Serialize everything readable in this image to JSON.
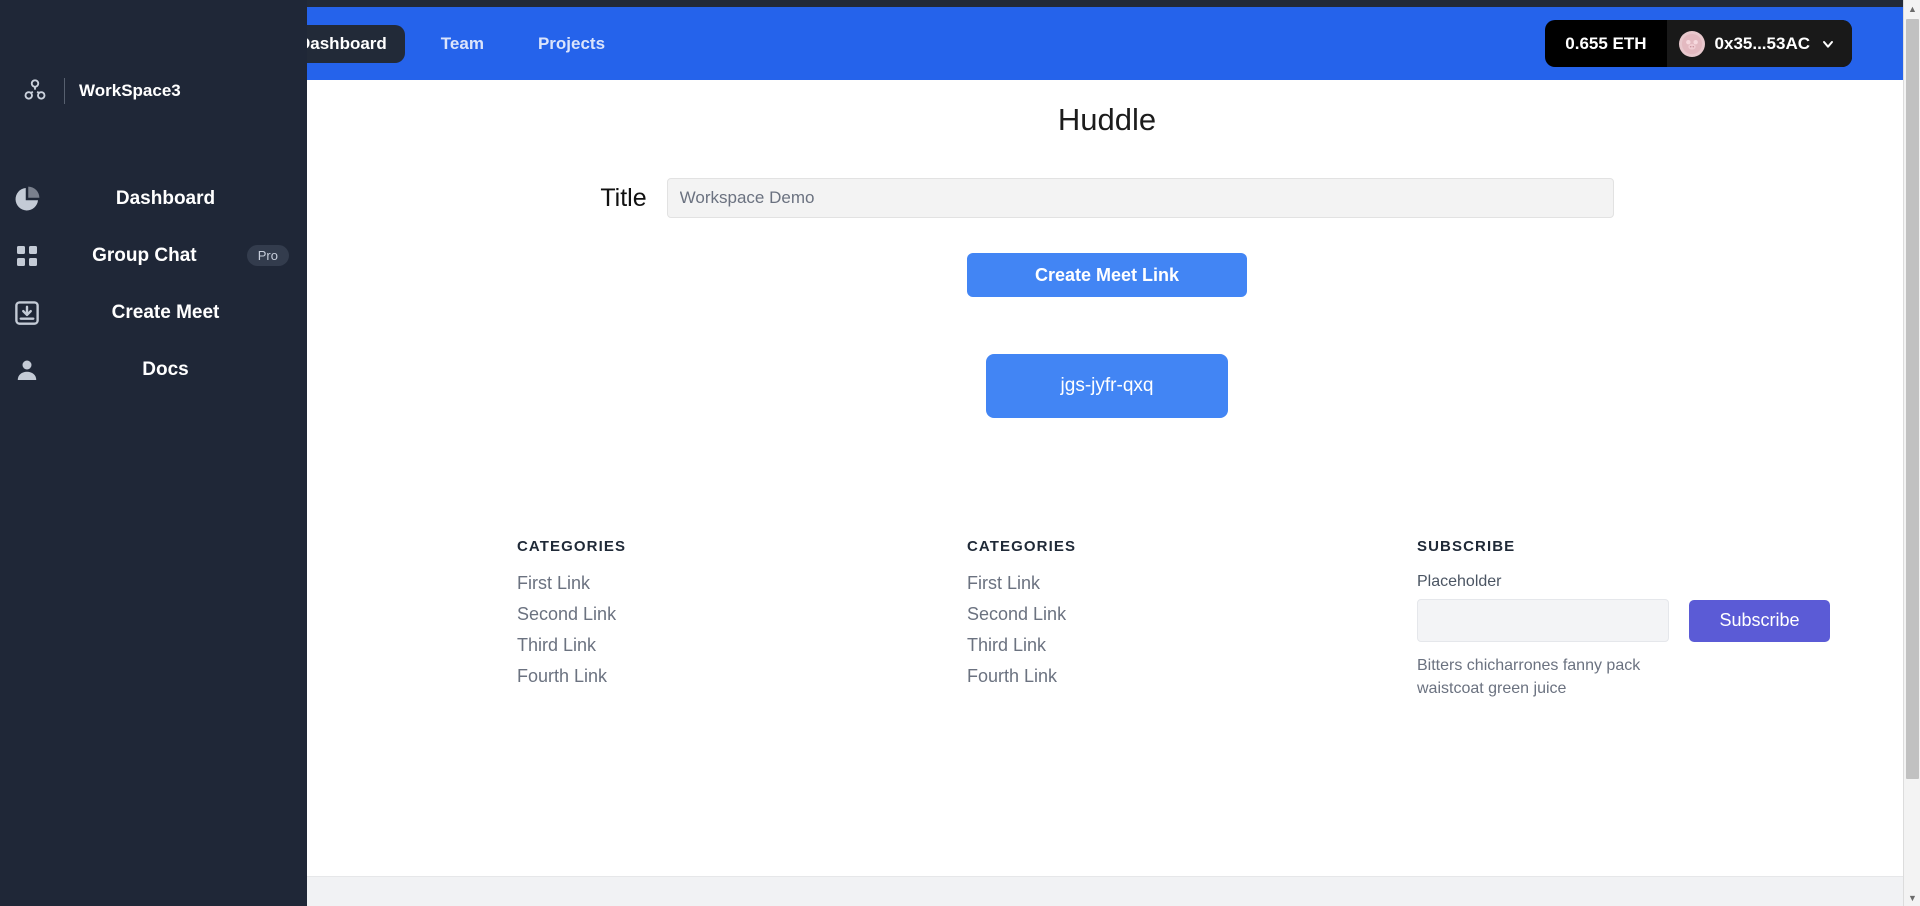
{
  "navbar": {
    "tabs": [
      {
        "label": "Dashboard",
        "active": true
      },
      {
        "label": "Team",
        "active": false
      },
      {
        "label": "Projects",
        "active": false
      }
    ],
    "wallet": {
      "balance": "0.655 ETH",
      "address": "0x35...53AC",
      "avatar_icon": "pig-avatar-icon",
      "chevron_icon": "chevron-down-icon",
      "accent_color": "#2563eb",
      "chip_color": "#000000"
    }
  },
  "sidebar": {
    "workspace": {
      "name": "WorkSpace3",
      "icon": "users-group-icon"
    },
    "background_color": "#1f2737",
    "items": [
      {
        "label": "Dashboard",
        "icon": "pie-chart-icon",
        "badge": ""
      },
      {
        "label": "Group Chat",
        "icon": "grid-squares-icon",
        "badge": "Pro"
      },
      {
        "label": "Create Meet",
        "icon": "inbox-download-icon",
        "badge": ""
      },
      {
        "label": "Docs",
        "icon": "user-person-icon",
        "badge": ""
      }
    ]
  },
  "main": {
    "page_title": "Huddle",
    "title_field": {
      "label": "Title",
      "value": "",
      "placeholder": "Workspace Demo"
    },
    "create_button": "Create Meet Link",
    "meet_link_code": "jgs-jyfr-qxq",
    "button_color": "#4285f4"
  },
  "footer": {
    "columns": [
      {
        "heading": "CATEGORIES",
        "links": [
          "First Link",
          "Second Link",
          "Third Link",
          "Fourth Link"
        ]
      },
      {
        "heading": "CATEGORIES",
        "links": [
          "First Link",
          "Second Link",
          "Third Link",
          "Fourth Link"
        ]
      }
    ],
    "subscribe": {
      "heading": "SUBSCRIBE",
      "field_label": "Placeholder",
      "field_value": "",
      "button_label": "Subscribe",
      "note": "Bitters chicharrones fanny pack waistcoat green juice",
      "button_color": "#5b5bd6"
    }
  }
}
